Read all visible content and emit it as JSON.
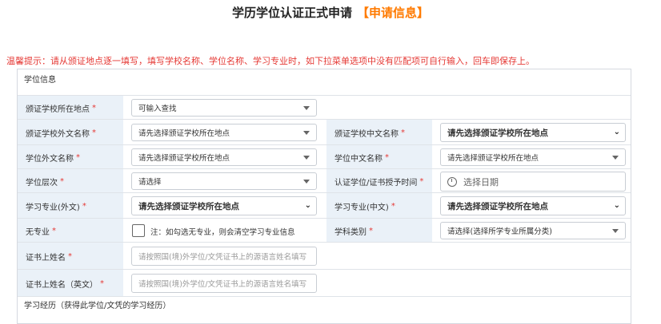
{
  "page": {
    "title": "学历学位认证正式申请",
    "title_highlight": "【申请信息】",
    "notice": "温馨提示：请从颁证地点逐一填写，填写学校名称、学位名称、学习专业时，如下拉菜单选项中没有匹配项可自行输入，回车即保存上。"
  },
  "sections": {
    "degree_info": "学位信息",
    "study_history": "学习经历（获得此学位/文凭的学习经历）"
  },
  "fields": {
    "school_location": {
      "label": "颁证学校所在地点",
      "value": "可输入查找"
    },
    "school_foreign_name": {
      "label": "颁证学校外文名称",
      "value": "请先选择颁证学校所在地点"
    },
    "school_chinese_name": {
      "label": "颁证学校中文名称",
      "value": "请先选择颁证学校所在地点"
    },
    "degree_foreign_name": {
      "label": "学位外文名称",
      "value": "请先选择颁证学校所在地点"
    },
    "degree_chinese_name": {
      "label": "学位中文名称",
      "value": "请先选择颁证学校所在地点"
    },
    "degree_level": {
      "label": "学位层次",
      "value": "请选择"
    },
    "award_date": {
      "label": "认证学位/证书授予时间",
      "placeholder": "选择日期"
    },
    "major_foreign": {
      "label": "学习专业(外文)",
      "value": "请先选择颁证学校所在地点"
    },
    "major_chinese": {
      "label": "学习专业(中文)",
      "value": "请先选择颁证学校所在地点"
    },
    "no_major": {
      "label": "无专业",
      "note": "注：如勾选无专业，则会清空学习专业信息"
    },
    "discipline": {
      "label": "学科类别",
      "value": "请选择(选择所学专业所属分类)"
    },
    "name_on_cert": {
      "label": "证书上姓名",
      "placeholder": "请按照国(境)外学位/文凭证书上的源语言姓名填写"
    },
    "name_on_cert_en": {
      "label": "证书上姓名（英文）",
      "placeholder": "请按照国(境)外学位/文凭证书上的源语言姓名填写"
    }
  },
  "required_mark": "*",
  "colors": {
    "accent": "#ff7a00",
    "notice": "#e53935",
    "label_bg": "#eaf1f8"
  }
}
